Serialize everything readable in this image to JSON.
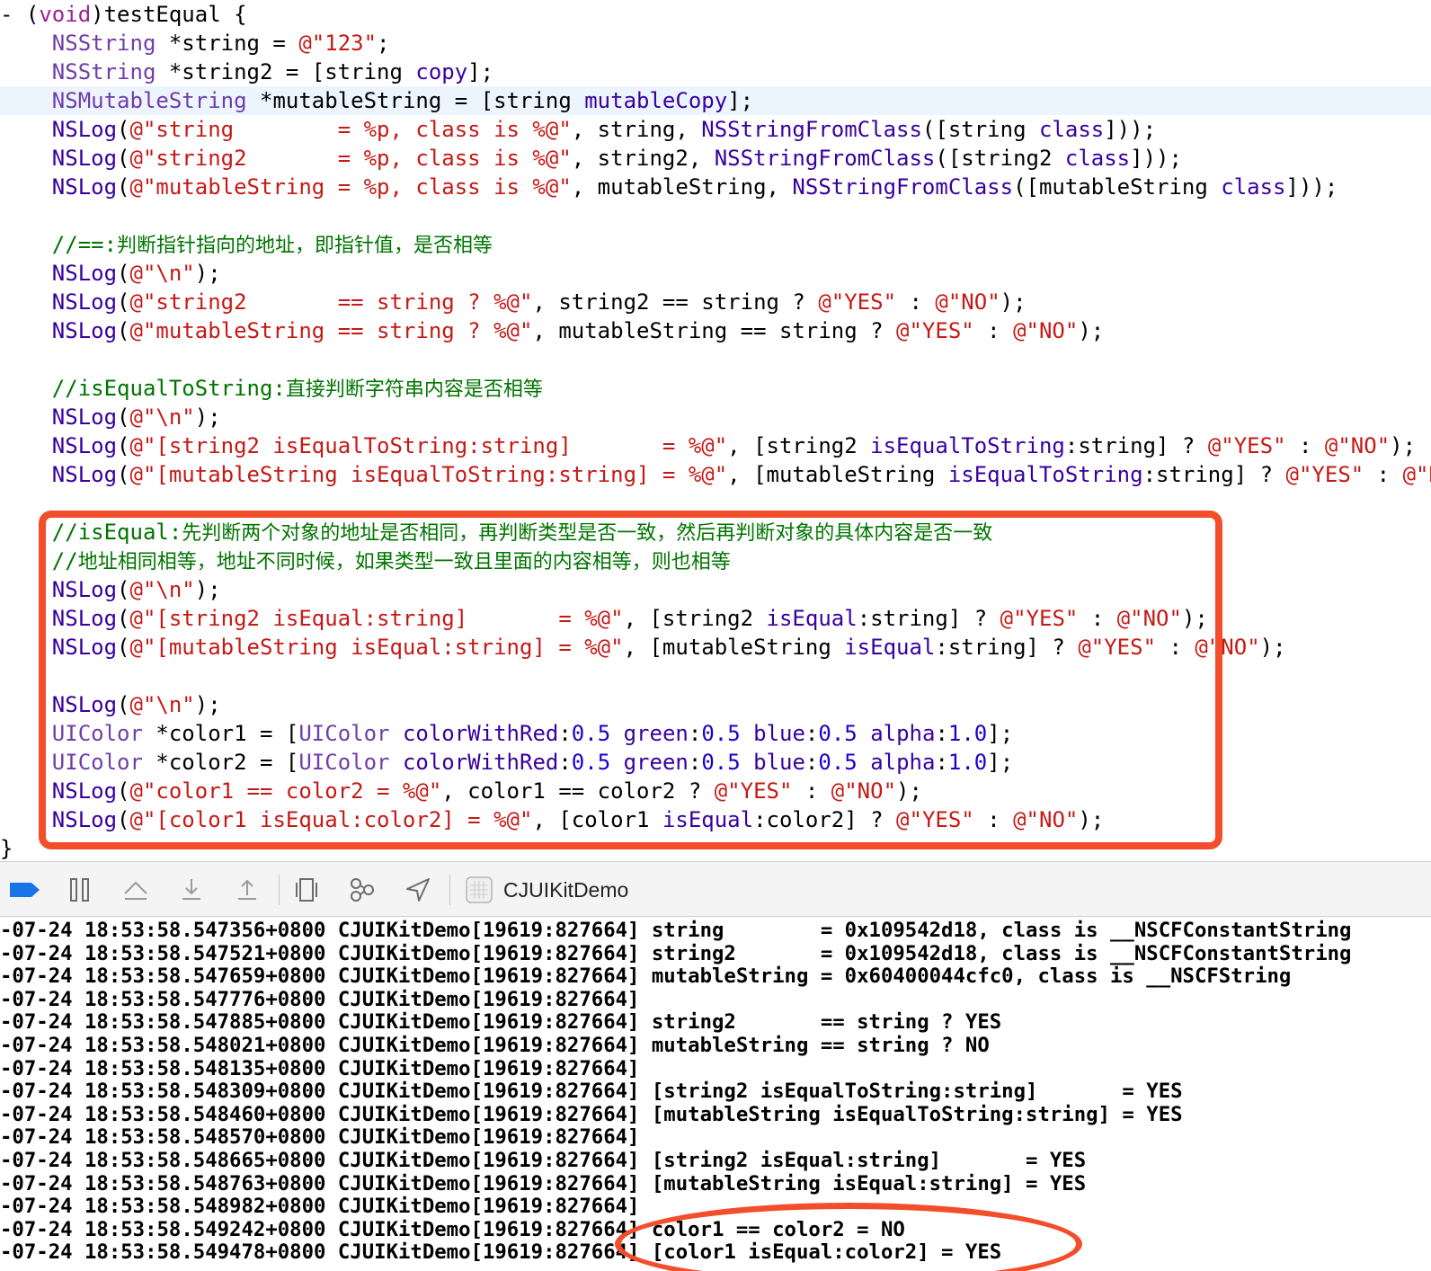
{
  "accent_color": "#f24e2c",
  "editor": {
    "lines": [
      {
        "hl": false,
        "tokens": [
          [
            "plain",
            "- ("
          ],
          [
            "keyword",
            "void"
          ],
          [
            "plain",
            ")testEqual {"
          ]
        ]
      },
      {
        "hl": false,
        "tokens": [
          [
            "plain",
            "    "
          ],
          [
            "type",
            "NSString"
          ],
          [
            "plain",
            " *string = "
          ],
          [
            "string",
            "@\"123\""
          ],
          [
            "plain",
            ";"
          ]
        ]
      },
      {
        "hl": false,
        "tokens": [
          [
            "plain",
            "    "
          ],
          [
            "type",
            "NSString"
          ],
          [
            "plain",
            " *string2 = [string "
          ],
          [
            "func",
            "copy"
          ],
          [
            "plain",
            "];"
          ]
        ]
      },
      {
        "hl": true,
        "tokens": [
          [
            "plain",
            "    "
          ],
          [
            "type",
            "NSMutableString"
          ],
          [
            "plain",
            " *mutableString = [string "
          ],
          [
            "func",
            "mutableCopy"
          ],
          [
            "plain",
            "];"
          ]
        ]
      },
      {
        "hl": false,
        "tokens": [
          [
            "plain",
            "    "
          ],
          [
            "func",
            "NSLog"
          ],
          [
            "plain",
            "("
          ],
          [
            "string",
            "@\"string        = %p, class is %@\""
          ],
          [
            "plain",
            ", string, "
          ],
          [
            "func",
            "NSStringFromClass"
          ],
          [
            "plain",
            "([string "
          ],
          [
            "func",
            "class"
          ],
          [
            "plain",
            "]));"
          ]
        ]
      },
      {
        "hl": false,
        "tokens": [
          [
            "plain",
            "    "
          ],
          [
            "func",
            "NSLog"
          ],
          [
            "plain",
            "("
          ],
          [
            "string",
            "@\"string2       = %p, class is %@\""
          ],
          [
            "plain",
            ", string2, "
          ],
          [
            "func",
            "NSStringFromClass"
          ],
          [
            "plain",
            "([string2 "
          ],
          [
            "func",
            "class"
          ],
          [
            "plain",
            "]));"
          ]
        ]
      },
      {
        "hl": false,
        "tokens": [
          [
            "plain",
            "    "
          ],
          [
            "func",
            "NSLog"
          ],
          [
            "plain",
            "("
          ],
          [
            "string",
            "@\"mutableString = %p, class is %@\""
          ],
          [
            "plain",
            ", mutableString, "
          ],
          [
            "func",
            "NSStringFromClass"
          ],
          [
            "plain",
            "([mutableString "
          ],
          [
            "func",
            "class"
          ],
          [
            "plain",
            "]));"
          ]
        ]
      },
      {
        "hl": false,
        "tokens": []
      },
      {
        "hl": false,
        "tokens": [
          [
            "plain",
            "    "
          ],
          [
            "comment",
            "//==:"
          ],
          [
            "cn",
            "判断指针指向的地址，即指针值，是否相等"
          ]
        ]
      },
      {
        "hl": false,
        "tokens": [
          [
            "plain",
            "    "
          ],
          [
            "func",
            "NSLog"
          ],
          [
            "plain",
            "("
          ],
          [
            "string",
            "@\"\\n\""
          ],
          [
            "plain",
            ");"
          ]
        ]
      },
      {
        "hl": false,
        "tokens": [
          [
            "plain",
            "    "
          ],
          [
            "func",
            "NSLog"
          ],
          [
            "plain",
            "("
          ],
          [
            "string",
            "@\"string2       == string ? %@\""
          ],
          [
            "plain",
            ", string2 == string ? "
          ],
          [
            "string",
            "@\"YES\""
          ],
          [
            "plain",
            " : "
          ],
          [
            "string",
            "@\"NO\""
          ],
          [
            "plain",
            ");"
          ]
        ]
      },
      {
        "hl": false,
        "tokens": [
          [
            "plain",
            "    "
          ],
          [
            "func",
            "NSLog"
          ],
          [
            "plain",
            "("
          ],
          [
            "string",
            "@\"mutableString == string ? %@\""
          ],
          [
            "plain",
            ", mutableString == string ? "
          ],
          [
            "string",
            "@\"YES\""
          ],
          [
            "plain",
            " : "
          ],
          [
            "string",
            "@\"NO\""
          ],
          [
            "plain",
            ");"
          ]
        ]
      },
      {
        "hl": false,
        "tokens": []
      },
      {
        "hl": false,
        "tokens": [
          [
            "plain",
            "    "
          ],
          [
            "comment",
            "//isEqualToString:"
          ],
          [
            "cn",
            "直接判断字符串内容是否相等"
          ]
        ]
      },
      {
        "hl": false,
        "tokens": [
          [
            "plain",
            "    "
          ],
          [
            "func",
            "NSLog"
          ],
          [
            "plain",
            "("
          ],
          [
            "string",
            "@\"\\n\""
          ],
          [
            "plain",
            ");"
          ]
        ]
      },
      {
        "hl": false,
        "tokens": [
          [
            "plain",
            "    "
          ],
          [
            "func",
            "NSLog"
          ],
          [
            "plain",
            "("
          ],
          [
            "string",
            "@\"[string2 isEqualToString:string]       = %@\""
          ],
          [
            "plain",
            ", [string2 "
          ],
          [
            "func",
            "isEqualToString"
          ],
          [
            "plain",
            ":string] ? "
          ],
          [
            "string",
            "@\"YES\""
          ],
          [
            "plain",
            " : "
          ],
          [
            "string",
            "@\"NO\""
          ],
          [
            "plain",
            ");"
          ]
        ]
      },
      {
        "hl": false,
        "tokens": [
          [
            "plain",
            "    "
          ],
          [
            "func",
            "NSLog"
          ],
          [
            "plain",
            "("
          ],
          [
            "string",
            "@\"[mutableString isEqualToString:string] = %@\""
          ],
          [
            "plain",
            ", [mutableString "
          ],
          [
            "func",
            "isEqualToString"
          ],
          [
            "plain",
            ":string] ? "
          ],
          [
            "string",
            "@\"YES\""
          ],
          [
            "plain",
            " : "
          ],
          [
            "string",
            "@\"NO\""
          ],
          [
            "plain",
            ");"
          ]
        ]
      },
      {
        "hl": false,
        "tokens": []
      },
      {
        "hl": false,
        "tokens": [
          [
            "plain",
            "    "
          ],
          [
            "comment",
            "//isEqual:"
          ],
          [
            "cn",
            "先判断两个对象的地址是否相同，再判断类型是否一致，然后再判断对象的具体内容是否一致"
          ]
        ]
      },
      {
        "hl": false,
        "tokens": [
          [
            "plain",
            "    "
          ],
          [
            "comment",
            "//"
          ],
          [
            "cn",
            "地址相同相等，地址不同时候，如果类型一致且里面的内容相等，则也相等"
          ]
        ]
      },
      {
        "hl": false,
        "tokens": [
          [
            "plain",
            "    "
          ],
          [
            "func",
            "NSLog"
          ],
          [
            "plain",
            "("
          ],
          [
            "string",
            "@\"\\n\""
          ],
          [
            "plain",
            ");"
          ]
        ]
      },
      {
        "hl": false,
        "tokens": [
          [
            "plain",
            "    "
          ],
          [
            "func",
            "NSLog"
          ],
          [
            "plain",
            "("
          ],
          [
            "string",
            "@\"[string2 isEqual:string]       = %@\""
          ],
          [
            "plain",
            ", [string2 "
          ],
          [
            "func",
            "isEqual"
          ],
          [
            "plain",
            ":string] ? "
          ],
          [
            "string",
            "@\"YES\""
          ],
          [
            "plain",
            " : "
          ],
          [
            "string",
            "@\"NO\""
          ],
          [
            "plain",
            ");"
          ]
        ]
      },
      {
        "hl": false,
        "tokens": [
          [
            "plain",
            "    "
          ],
          [
            "func",
            "NSLog"
          ],
          [
            "plain",
            "("
          ],
          [
            "string",
            "@\"[mutableString isEqual:string] = %@\""
          ],
          [
            "plain",
            ", [mutableString "
          ],
          [
            "func",
            "isEqual"
          ],
          [
            "plain",
            ":string] ? "
          ],
          [
            "string",
            "@\"YES\""
          ],
          [
            "plain",
            " : "
          ],
          [
            "string",
            "@\"NO\""
          ],
          [
            "plain",
            ");"
          ]
        ]
      },
      {
        "hl": false,
        "tokens": []
      },
      {
        "hl": false,
        "tokens": [
          [
            "plain",
            "    "
          ],
          [
            "func",
            "NSLog"
          ],
          [
            "plain",
            "("
          ],
          [
            "string",
            "@\"\\n\""
          ],
          [
            "plain",
            ");"
          ]
        ]
      },
      {
        "hl": false,
        "tokens": [
          [
            "plain",
            "    "
          ],
          [
            "type",
            "UIColor"
          ],
          [
            "plain",
            " *color1 = ["
          ],
          [
            "type",
            "UIColor"
          ],
          [
            "plain",
            " "
          ],
          [
            "func",
            "colorWithRed"
          ],
          [
            "plain",
            ":"
          ],
          [
            "number",
            "0.5"
          ],
          [
            "plain",
            " "
          ],
          [
            "func",
            "green"
          ],
          [
            "plain",
            ":"
          ],
          [
            "number",
            "0.5"
          ],
          [
            "plain",
            " "
          ],
          [
            "func",
            "blue"
          ],
          [
            "plain",
            ":"
          ],
          [
            "number",
            "0.5"
          ],
          [
            "plain",
            " "
          ],
          [
            "func",
            "alpha"
          ],
          [
            "plain",
            ":"
          ],
          [
            "number",
            "1.0"
          ],
          [
            "plain",
            "];"
          ]
        ]
      },
      {
        "hl": false,
        "tokens": [
          [
            "plain",
            "    "
          ],
          [
            "type",
            "UIColor"
          ],
          [
            "plain",
            " *color2 = ["
          ],
          [
            "type",
            "UIColor"
          ],
          [
            "plain",
            " "
          ],
          [
            "func",
            "colorWithRed"
          ],
          [
            "plain",
            ":"
          ],
          [
            "number",
            "0.5"
          ],
          [
            "plain",
            " "
          ],
          [
            "func",
            "green"
          ],
          [
            "plain",
            ":"
          ],
          [
            "number",
            "0.5"
          ],
          [
            "plain",
            " "
          ],
          [
            "func",
            "blue"
          ],
          [
            "plain",
            ":"
          ],
          [
            "number",
            "0.5"
          ],
          [
            "plain",
            " "
          ],
          [
            "func",
            "alpha"
          ],
          [
            "plain",
            ":"
          ],
          [
            "number",
            "1.0"
          ],
          [
            "plain",
            "];"
          ]
        ]
      },
      {
        "hl": false,
        "tokens": [
          [
            "plain",
            "    "
          ],
          [
            "func",
            "NSLog"
          ],
          [
            "plain",
            "("
          ],
          [
            "string",
            "@\"color1 == color2 = %@\""
          ],
          [
            "plain",
            ", color1 == color2 ? "
          ],
          [
            "string",
            "@\"YES\""
          ],
          [
            "plain",
            " : "
          ],
          [
            "string",
            "@\"NO\""
          ],
          [
            "plain",
            ");"
          ]
        ]
      },
      {
        "hl": false,
        "tokens": [
          [
            "plain",
            "    "
          ],
          [
            "func",
            "NSLog"
          ],
          [
            "plain",
            "("
          ],
          [
            "string",
            "@\"[color1 isEqual:color2] = %@\""
          ],
          [
            "plain",
            ", [color1 "
          ],
          [
            "func",
            "isEqual"
          ],
          [
            "plain",
            ":color2] ? "
          ],
          [
            "string",
            "@\"YES\""
          ],
          [
            "plain",
            " : "
          ],
          [
            "string",
            "@\"NO\""
          ],
          [
            "plain",
            ");"
          ]
        ]
      },
      {
        "hl": false,
        "tokens": [
          [
            "plain",
            "}"
          ]
        ]
      }
    ]
  },
  "debug_bar": {
    "app_name": "CJUIKitDemo",
    "icons": [
      "breakpoint-icon",
      "pause-icon",
      "step-over-icon",
      "step-into-icon",
      "step-out-icon",
      "view-hierarchy-icon",
      "memory-graph-icon",
      "location-icon",
      "app-icon"
    ]
  },
  "console": {
    "lines": [
      "-07-24 18:53:58.547356+0800 CJUIKitDemo[19619:827664] string        = 0x109542d18, class is __NSCFConstantString",
      "-07-24 18:53:58.547521+0800 CJUIKitDemo[19619:827664] string2       = 0x109542d18, class is __NSCFConstantString",
      "-07-24 18:53:58.547659+0800 CJUIKitDemo[19619:827664] mutableString = 0x60400044cfc0, class is __NSCFString",
      "-07-24 18:53:58.547776+0800 CJUIKitDemo[19619:827664]",
      "-07-24 18:53:58.547885+0800 CJUIKitDemo[19619:827664] string2       == string ? YES",
      "-07-24 18:53:58.548021+0800 CJUIKitDemo[19619:827664] mutableString == string ? NO",
      "-07-24 18:53:58.548135+0800 CJUIKitDemo[19619:827664]",
      "-07-24 18:53:58.548309+0800 CJUIKitDemo[19619:827664] [string2 isEqualToString:string]       = YES",
      "-07-24 18:53:58.548460+0800 CJUIKitDemo[19619:827664] [mutableString isEqualToString:string] = YES",
      "-07-24 18:53:58.548570+0800 CJUIKitDemo[19619:827664]",
      "-07-24 18:53:58.548665+0800 CJUIKitDemo[19619:827664] [string2 isEqual:string]       = YES",
      "-07-24 18:53:58.548763+0800 CJUIKitDemo[19619:827664] [mutableString isEqual:string] = YES",
      "-07-24 18:53:58.548982+0800 CJUIKitDemo[19619:827664]",
      "-07-24 18:53:58.549242+0800 CJUIKitDemo[19619:827664] color1 == color2 = NO",
      "-07-24 18:53:58.549478+0800 CJUIKitDemo[19619:827664] [color1 isEqual:color2] = YES"
    ]
  }
}
